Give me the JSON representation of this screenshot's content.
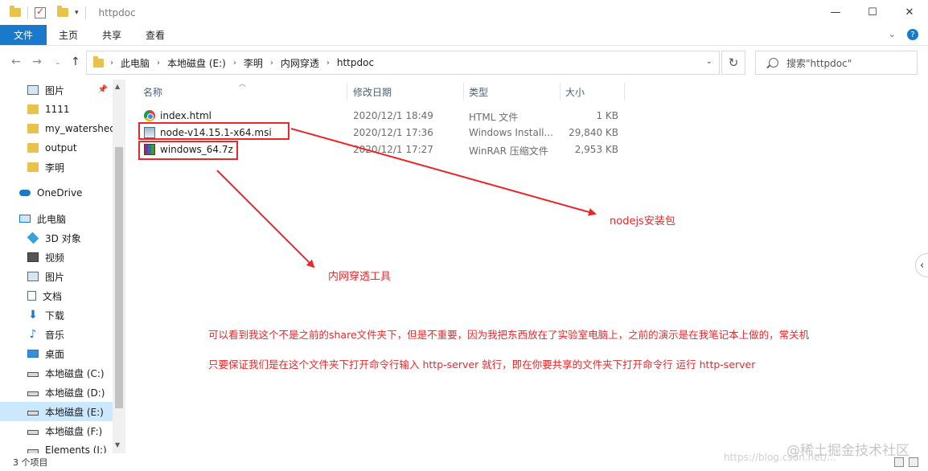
{
  "window": {
    "title": "httpdoc",
    "controls": {
      "minimize": "—",
      "maximize": "☐",
      "close": "✕"
    }
  },
  "ribbon": {
    "tabs": [
      "文件",
      "主页",
      "共享",
      "查看"
    ],
    "help": "?"
  },
  "address": {
    "crumbs": [
      "此电脑",
      "本地磁盘 (E:)",
      "李明",
      "内网穿透",
      "httpdoc"
    ],
    "search_placeholder": "搜索\"httpdoc\""
  },
  "nav": {
    "items": [
      {
        "label": "图片",
        "icon": "pictures-icon",
        "pinned": true
      },
      {
        "label": "1111",
        "icon": "folder-icon"
      },
      {
        "label": "my_watershed",
        "icon": "folder-icon"
      },
      {
        "label": "output",
        "icon": "folder-icon"
      },
      {
        "label": "李明",
        "icon": "folder-icon"
      },
      {
        "label": "OneDrive",
        "icon": "onedrive-icon"
      },
      {
        "label": "此电脑",
        "icon": "this-pc-icon"
      },
      {
        "label": "3D 对象",
        "icon": "3d-objects-icon"
      },
      {
        "label": "视频",
        "icon": "videos-icon"
      },
      {
        "label": "图片",
        "icon": "pictures-icon"
      },
      {
        "label": "文档",
        "icon": "documents-icon"
      },
      {
        "label": "下载",
        "icon": "downloads-icon"
      },
      {
        "label": "音乐",
        "icon": "music-icon"
      },
      {
        "label": "桌面",
        "icon": "desktop-icon"
      },
      {
        "label": "本地磁盘 (C:)",
        "icon": "drive-icon"
      },
      {
        "label": "本地磁盘 (D:)",
        "icon": "drive-icon"
      },
      {
        "label": "本地磁盘 (E:)",
        "icon": "drive-icon",
        "selected": true
      },
      {
        "label": "本地磁盘 (F:)",
        "icon": "drive-icon"
      },
      {
        "label": "Elements (I:)",
        "icon": "drive-icon"
      }
    ]
  },
  "columns": {
    "name": "名称",
    "date": "修改日期",
    "type": "类型",
    "size": "大小"
  },
  "files": [
    {
      "name": "index.html",
      "date": "2020/12/1 18:49",
      "type": "HTML 文件",
      "size": "1 KB",
      "icon": "chrome-html-icon"
    },
    {
      "name": "node-v14.15.1-x64.msi",
      "date": "2020/12/1 17:36",
      "type": "Windows Install...",
      "size": "29,840 KB",
      "icon": "msi-installer-icon"
    },
    {
      "name": "windows_64.7z",
      "date": "2020/12/1 17:27",
      "type": "WinRAR 压缩文件",
      "size": "2,953 KB",
      "icon": "winrar-archive-icon"
    }
  ],
  "annotations": {
    "nodejs": "nodejs安装包",
    "tool": "内网穿透工具",
    "line1": "可以看到我这个不是之前的share文件夹下，但是不重要，因为我把东西放在了实验室电脑上，之前的演示是在我笔记本上做的，常关机",
    "line2": "只要保证我们是在这个文件夹下打开命令行输入 http-server 就行，即在你要共享的文件夹下打开命令行 运行 http-server",
    "color": "#e8282b"
  },
  "status": {
    "count": "3 个项目"
  },
  "watermark": {
    "brand": "@稀土掘金技术社区",
    "url": "https://blog.csdn.net/..."
  }
}
